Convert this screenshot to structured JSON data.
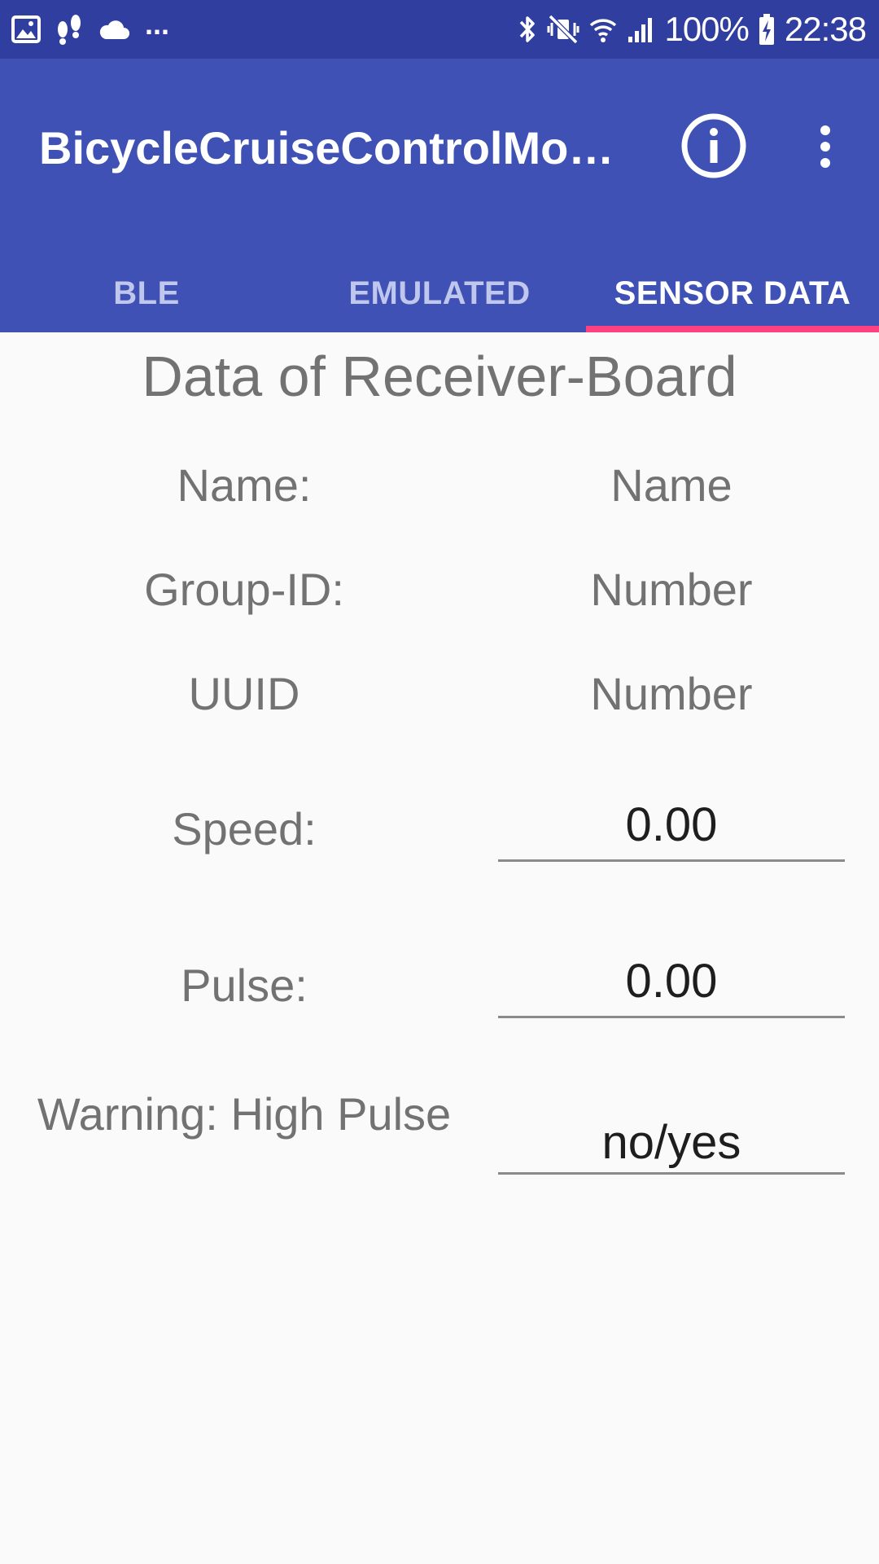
{
  "status_bar": {
    "left_more": "...",
    "battery_percent": "100%",
    "time": "22:38",
    "icons_left": [
      "gallery-icon",
      "footsteps-icon",
      "cloud-icon"
    ],
    "icons_right": [
      "bluetooth-icon",
      "vibrate-mute-icon",
      "wifi-icon",
      "signal-icon",
      "battery-charging-icon"
    ]
  },
  "app_bar": {
    "title": "BicycleCruiseControlMoc…",
    "info_icon": "info-icon",
    "more_icon": "more-vert-icon",
    "background_color": "#3f51b5",
    "status_color": "#303f9f",
    "indicator_color": "#ff4081"
  },
  "tabs": [
    {
      "label": "BLE",
      "active": false
    },
    {
      "label": "EMULATED",
      "active": false
    },
    {
      "label": "SENSOR DATA",
      "active": true
    }
  ],
  "content": {
    "title": "Data of Receiver-Board",
    "rows": [
      {
        "label": "Name:",
        "value": "Name"
      },
      {
        "label": "Group-ID:",
        "value": "Number"
      },
      {
        "label": "UUID",
        "value": "Number"
      }
    ],
    "fields": [
      {
        "label": "Speed:",
        "value": "0.00"
      },
      {
        "label": "Pulse:",
        "value": "0.00"
      },
      {
        "label": "Warning: High Pulse",
        "value": "no/yes"
      }
    ]
  }
}
